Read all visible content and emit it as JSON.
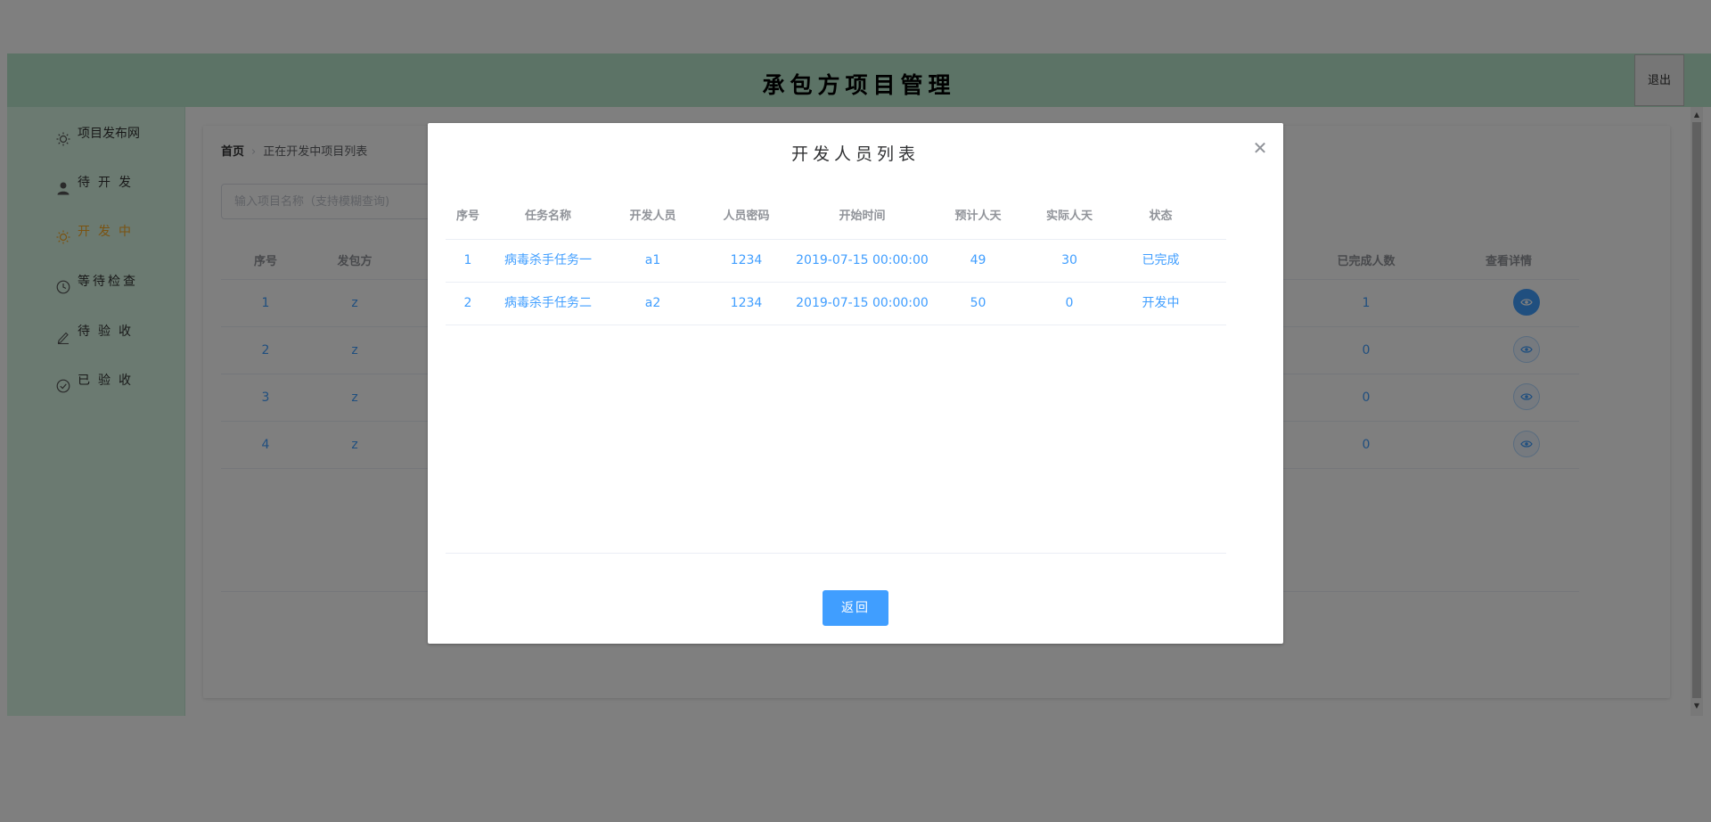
{
  "app": {
    "title": "承包方项目管理",
    "logout_label": "退出"
  },
  "sidebar": {
    "items": [
      {
        "label": "项目发布网",
        "icon": "sun-icon",
        "active": false
      },
      {
        "label": "待开发",
        "icon": "user-icon",
        "active": false
      },
      {
        "label": "开发中",
        "icon": "sun-icon",
        "active": true
      },
      {
        "label": "等待检查",
        "icon": "clock-icon",
        "active": false
      },
      {
        "label": "待验收",
        "icon": "edit-icon",
        "active": false
      },
      {
        "label": "已验收",
        "icon": "check-circle-icon",
        "active": false
      }
    ]
  },
  "breadcrumb": {
    "home": "首页",
    "current": "正在开发中项目列表"
  },
  "search": {
    "placeholder": "输入项目名称（支持模糊查询)"
  },
  "project_table": {
    "headers": {
      "index": "序号",
      "publisher": "发包方",
      "completed": "已完成人数",
      "details": "查看详情"
    },
    "rows": [
      {
        "index": "1",
        "publisher": "z",
        "completed": "1"
      },
      {
        "index": "2",
        "publisher": "z",
        "completed": "0"
      },
      {
        "index": "3",
        "publisher": "z",
        "completed": "0"
      },
      {
        "index": "4",
        "publisher": "z",
        "completed": "0"
      }
    ]
  },
  "modal": {
    "title": "开发人员列表",
    "close_icon": "close-icon",
    "back_label": "返回",
    "headers": [
      "序号",
      "任务名称",
      "开发人员",
      "人员密码",
      "开始时间",
      "预计人天",
      "实际人天",
      "状态"
    ],
    "rows": [
      {
        "index": "1",
        "task": "病毒杀手任务一",
        "developer": "a1",
        "password": "1234",
        "start": "2019-07-15 00:00:00",
        "estimated": "49",
        "actual": "30",
        "status": "已完成"
      },
      {
        "index": "2",
        "task": "病毒杀手任务二",
        "developer": "a2",
        "password": "1234",
        "start": "2019-07-15 00:00:00",
        "estimated": "50",
        "actual": "0",
        "status": "开发中"
      }
    ]
  },
  "colors": {
    "header_bg": "#b8e6cc",
    "sidebar_bg": "#d6f5e3",
    "accent": "#409eff",
    "active_menu": "#f5a623"
  }
}
